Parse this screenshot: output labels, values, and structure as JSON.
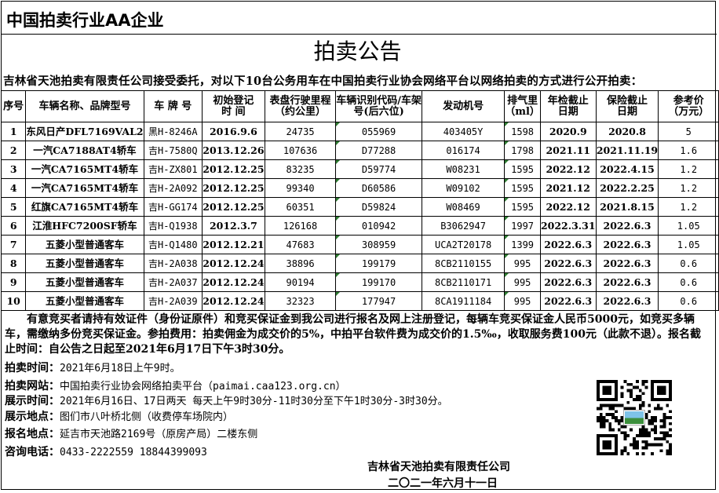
{
  "header": {
    "title": "中国拍卖行业AA企业"
  },
  "doc_title": "拍卖公告",
  "intro": "吉林省天池拍卖有限责任公司接受委托，对以下10台公务用车在中国拍卖行业协会网络平台以网络拍卖的方式进行公开拍卖：",
  "table": {
    "headers": [
      [
        "序号"
      ],
      [
        "车辆名称、品牌型号"
      ],
      [
        "车 牌 号"
      ],
      [
        "初始登记",
        "时 间"
      ],
      [
        "表盘行驶里程",
        "（约公里）"
      ],
      [
        "车辆识别代码/车架",
        "号(后六位)"
      ],
      [
        "发动机号"
      ],
      [
        "排气里",
        "（ml）"
      ],
      [
        "年检截止",
        "日期"
      ],
      [
        "保险截止",
        "日期"
      ],
      [
        "参考价",
        "（万元）"
      ]
    ],
    "rows": [
      [
        "1",
        "东风日产DFL7169VAL2",
        "黑H-8246A",
        "2016.9.6",
        "24735",
        "055969",
        "403405Y",
        "1598",
        "2020.9",
        "2020.8",
        "5"
      ],
      [
        "2",
        "一汽CA7188AT4轿车",
        "吉H-7580Q",
        "2013.12.26",
        "107636",
        "D77288",
        "016174",
        "1798",
        "2021.11",
        "2021.11.19",
        "1.6"
      ],
      [
        "3",
        "一汽CA7165MT4轿车",
        "吉H-ZX801",
        "2012.12.25",
        "83235",
        "D59774",
        "W08231",
        "1595",
        "2022.12",
        "2022.4.15",
        "1.2"
      ],
      [
        "4",
        "一汽CA7165MT4轿车",
        "吉H-2A092",
        "2012.12.25",
        "99340",
        "D60586",
        "W09102",
        "1595",
        "2021.12",
        "2022.2.25",
        "1.2"
      ],
      [
        "5",
        "红旗CA7165MT4轿车",
        "吉H-GG174",
        "2012.12.25",
        "60351",
        "D59824",
        "W08469",
        "1595",
        "2022.12",
        "2021.8.15",
        "1.2"
      ],
      [
        "6",
        "江淮HFC7200SF轿车",
        "吉H-Q1938",
        "2012.3.7",
        "126168",
        "010942",
        "B3062947",
        "1997",
        "2022.3.31",
        "2022.6.3",
        "1.05"
      ],
      [
        "7",
        "五菱小型普通客车",
        "吉H-Q1480",
        "2012.12.21",
        "47683",
        "308959",
        "UCA2T20178",
        "1399",
        "2022.6.3",
        "2022.6.3",
        "1.05"
      ],
      [
        "8",
        "五菱小型普通客车",
        "吉H-2A038",
        "2012.12.24",
        "38896",
        "199179",
        "8CB2110155",
        "995",
        "2022.6.3",
        "2022.6.3",
        "0.6"
      ],
      [
        "9",
        "五菱小型普通客车",
        "吉H-2A037",
        "2012.12.24",
        "90194",
        "199170",
        "8CB2110171",
        "995",
        "2022.6.3",
        "2022.6.3",
        "0.6"
      ],
      [
        "10",
        "五菱小型普通客车",
        "吉H-2A039",
        "2012.12.24",
        "32323",
        "177947",
        "8CA1911184",
        "995",
        "2022.6.3",
        "2022.6.3",
        "0.6"
      ]
    ]
  },
  "notice": "有意竞买者请持有效证件（身份证原件）和竞买保证金到我公司进行报名及网上注册登记，每辆车竞买保证金人民币5000元，如竞买多辆车，需缴纳多份竞买保证金。参拍费用：拍卖佣金为成交价的5%，中拍平台软件费为成交价的1.5‰，收取服务费100元（此款不退）。报名截止时间：自公告之日起至2021年6月17日下午3时30分。",
  "info": {
    "auction_time_label": "拍卖时间：",
    "auction_time": "2021年6月18日上午9时。",
    "website_label": "拍卖网站：",
    "website": "中国拍卖行业协会网络拍卖平台（paimai.caa123.org.cn）",
    "display_time_label": "展示时间：",
    "display_time": "2021年6月16日、17日两天  每天上午9时30分-11时30分至下午1时30分-3时30分。",
    "display_place_label": "展示地点：",
    "display_place": "图们市八叶桥北侧（收费停车场院内）",
    "signup_place_label": "报名地点：",
    "signup_place": "延吉市天池路2169号（原房产局）二楼东侧",
    "phone_label": "咨询电话：",
    "phone": "0433-2222559  18844399093"
  },
  "signature": {
    "company": "吉林省天池拍卖有限责任公司",
    "date": "二〇二一年六月十一日"
  },
  "icons": {
    "qr": "qr-code-icon"
  }
}
